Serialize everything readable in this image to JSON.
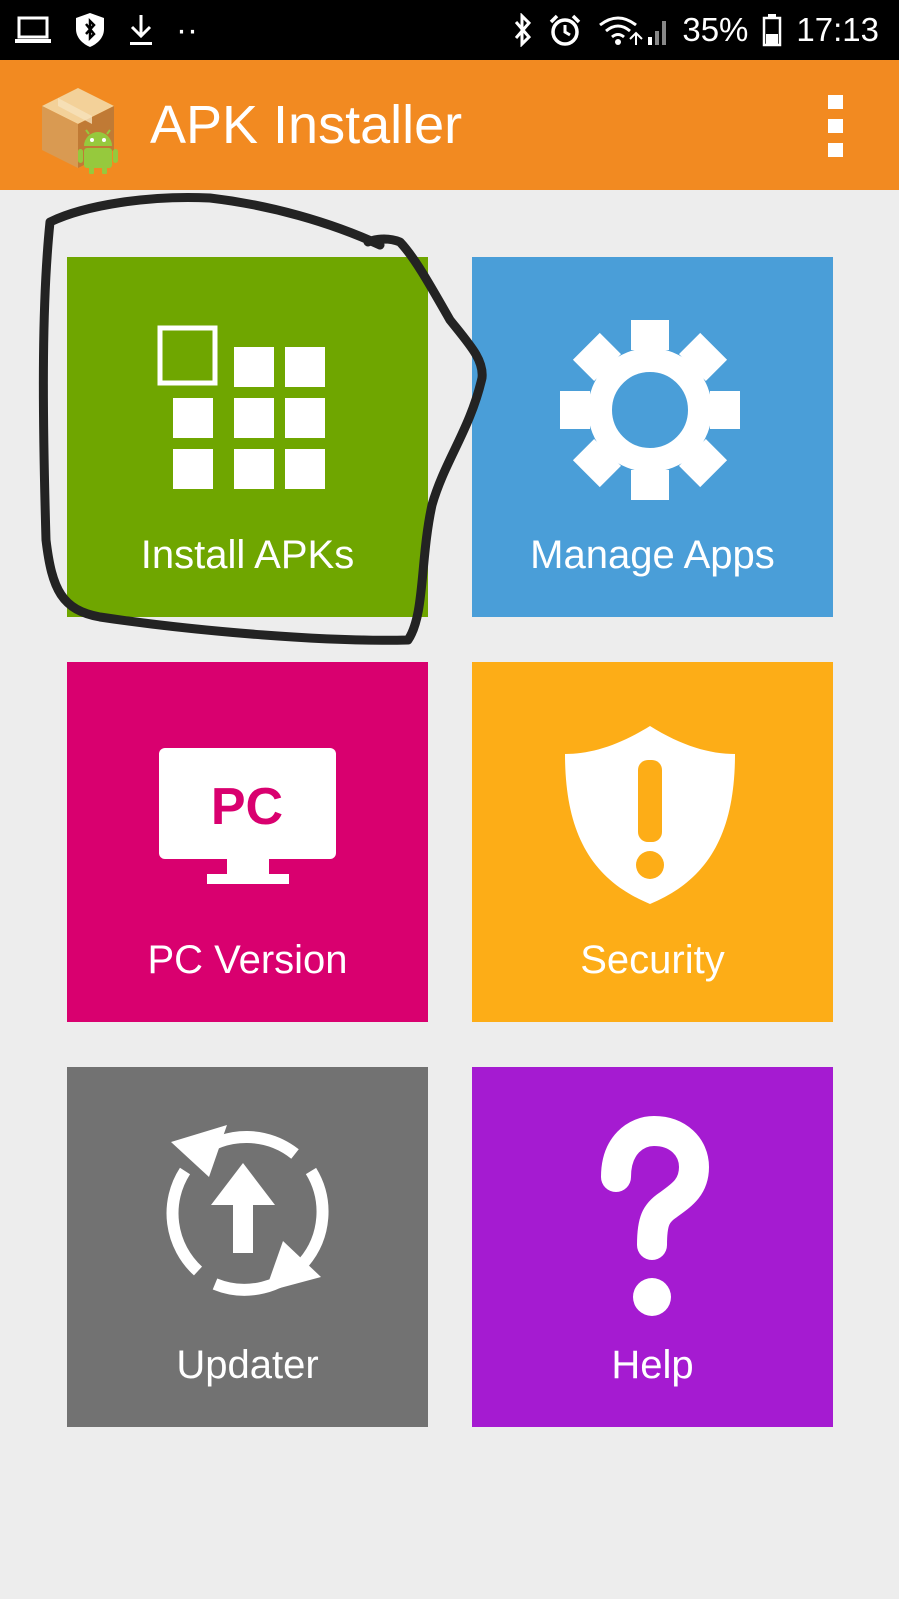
{
  "status_bar": {
    "battery": "35%",
    "time": "17:13",
    "dots": "··"
  },
  "app_bar": {
    "title": "APK Installer"
  },
  "tiles": [
    {
      "label": "Install APKs",
      "color": "#6fa600",
      "icon": "grid-icon"
    },
    {
      "label": "Manage Apps",
      "color": "#4a9ed8",
      "icon": "gear-icon"
    },
    {
      "label": "PC Version",
      "color": "#d9006f",
      "icon": "monitor-icon",
      "icon_text": "PC"
    },
    {
      "label": "Security",
      "color": "#fdad17",
      "icon": "shield-icon"
    },
    {
      "label": "Updater",
      "color": "#727272",
      "icon": "refresh-upload-icon"
    },
    {
      "label": "Help",
      "color": "#a51bd1",
      "icon": "question-icon"
    }
  ],
  "colors": {
    "app_bar": "#f28a21",
    "background": "#ededed",
    "annotation_stroke": "#232323"
  }
}
